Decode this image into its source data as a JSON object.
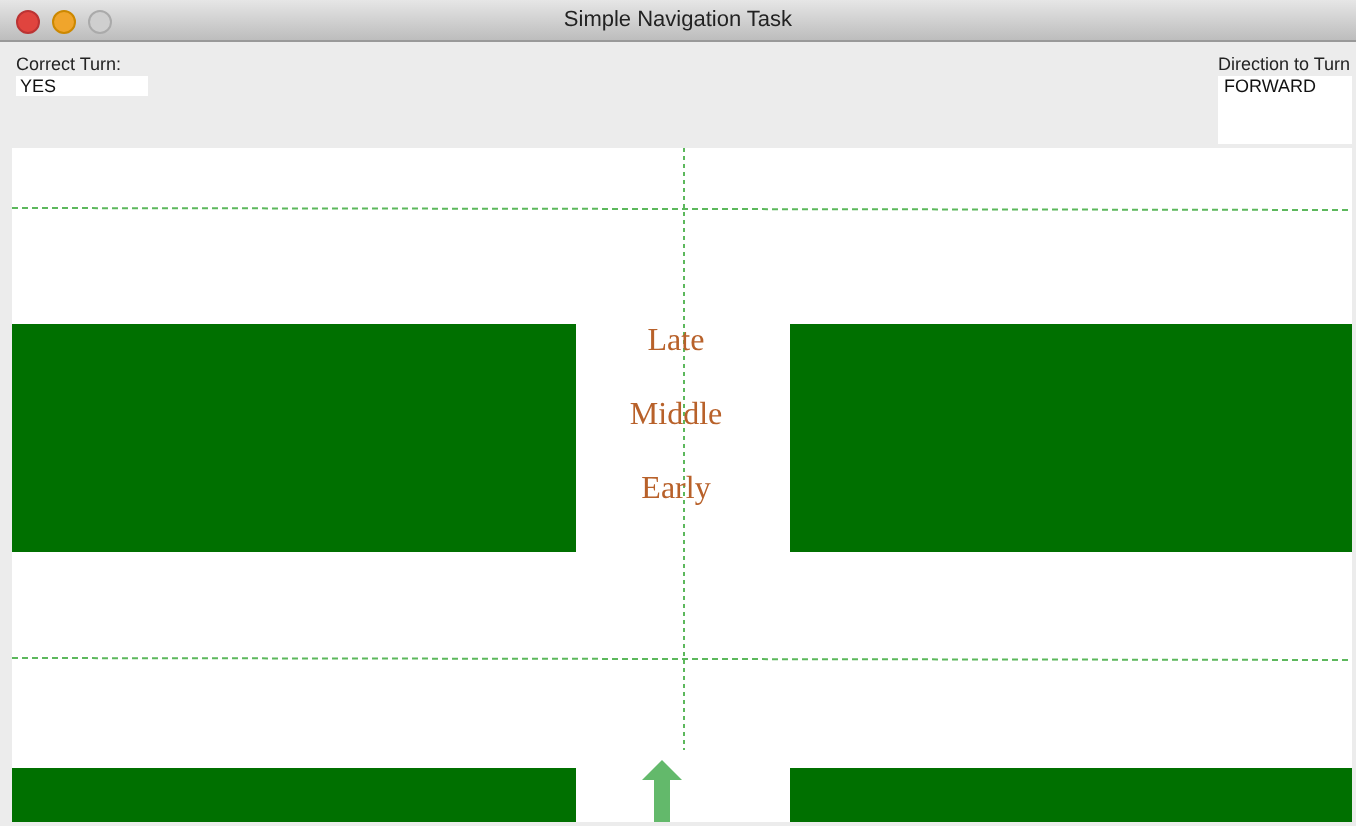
{
  "window": {
    "title": "Simple Navigation Task"
  },
  "correct_turn": {
    "label": "Correct Turn:",
    "value": "YES"
  },
  "direction": {
    "label": "Direction to Turn",
    "value": "FORWARD"
  },
  "timing_labels": [
    "Late",
    "Middle",
    "Early"
  ]
}
